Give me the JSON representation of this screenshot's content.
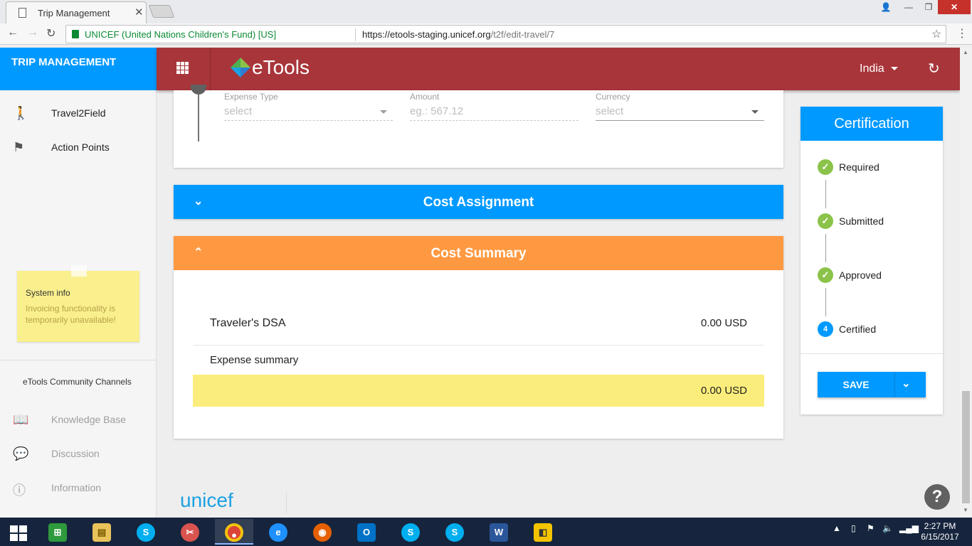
{
  "browser": {
    "tab_title": "Trip Management",
    "security_label": "UNICEF (United Nations Children's Fund) [US]",
    "url_host": "https://etools-staging.unicef.org",
    "url_path": "/t2f/edit-travel/7"
  },
  "sidebar": {
    "header": "TRIP MANAGEMENT",
    "items": [
      {
        "label": "Travel2Field",
        "icon": "walking-person-icon"
      },
      {
        "label": "Action Points",
        "icon": "flag-icon"
      }
    ],
    "system_info": {
      "title": "System info",
      "text": "Invoicing functionality is temporarily unavailable!"
    },
    "community_title": "eTools Community Channels",
    "community_items": [
      {
        "label": "Knowledge Base",
        "icon": "book-person-icon"
      },
      {
        "label": "Discussion",
        "icon": "chat-icon"
      },
      {
        "label": "Information",
        "icon": "info-icon"
      }
    ]
  },
  "topbar": {
    "logo_text": "eTools",
    "country": "India"
  },
  "expense_form": {
    "expense_type_label": "Expense Type",
    "expense_type_value": "select",
    "amount_label": "Amount",
    "amount_placeholder": "eg.: 567.12",
    "currency_label": "Currency",
    "currency_value": "select"
  },
  "panels": {
    "cost_assignment": "Cost Assignment",
    "cost_summary": "Cost Summary"
  },
  "cost_summary": {
    "dsa_label": "Traveler's DSA",
    "dsa_value": "0.00 USD",
    "expense_label": "Expense summary",
    "total_value": "0.00 USD"
  },
  "certification": {
    "title": "Certification",
    "steps": [
      {
        "name": "Required",
        "marker": "✓"
      },
      {
        "name": "Submitted",
        "marker": "✓"
      },
      {
        "name": "Approved",
        "marker": "✓"
      },
      {
        "name": "Certified",
        "marker": "4"
      }
    ],
    "save_label": "SAVE"
  },
  "footer": {
    "brand": "unicef",
    "help": "?"
  },
  "taskbar": {
    "time": "2:27 PM",
    "date": "6/15/2017"
  },
  "colors": {
    "primary": "#0099ff",
    "topbar": "#a8353a",
    "summary": "#ff9941",
    "highlight": "#fbed7c",
    "done": "#8bc34a"
  }
}
